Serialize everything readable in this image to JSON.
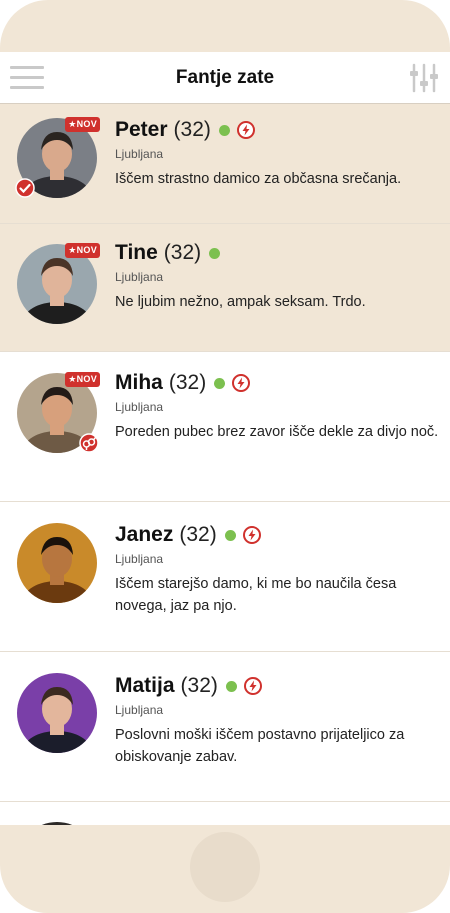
{
  "header": {
    "title": "Fantje zate",
    "menu_icon": "hamburger-menu-icon",
    "filter_icon": "sliders-filter-icon"
  },
  "badges": {
    "new_label": "NOV"
  },
  "colors": {
    "highlight_bg": "#f1e6d6",
    "badge_red": "#d0312d",
    "online_green": "#7cc04f"
  },
  "users": [
    {
      "name": "Peter",
      "age": "(32)",
      "city": "Ljubljana",
      "bio": "Iščem strastno damico za občasna srečanja.",
      "online": true,
      "flash": true,
      "new": true,
      "verified": true,
      "couple": false,
      "highlight": true
    },
    {
      "name": "Tine",
      "age": "(32)",
      "city": "Ljubljana",
      "bio": "Ne ljubim nežno, ampak seksam. Trdo.",
      "online": true,
      "flash": false,
      "new": true,
      "verified": false,
      "couple": false,
      "highlight": true
    },
    {
      "name": "Miha",
      "age": "(32)",
      "city": "Ljubljana",
      "bio": "Poreden pubec brez zavor išče dekle za divjo noč.",
      "online": true,
      "flash": true,
      "new": true,
      "verified": false,
      "couple": true,
      "highlight": false
    },
    {
      "name": "Janez",
      "age": "(32)",
      "city": "Ljubljana",
      "bio": "Iščem starejšo damo, ki me bo naučila česa novega, jaz pa njo.",
      "online": true,
      "flash": true,
      "new": false,
      "verified": false,
      "couple": false,
      "highlight": false
    },
    {
      "name": "Matija",
      "age": "(32)",
      "city": "Ljubljana",
      "bio": "Poslovni moški iščem postavno prijateljico za obiskovanje zabav.",
      "online": true,
      "flash": true,
      "new": false,
      "verified": false,
      "couple": false,
      "highlight": false
    }
  ]
}
